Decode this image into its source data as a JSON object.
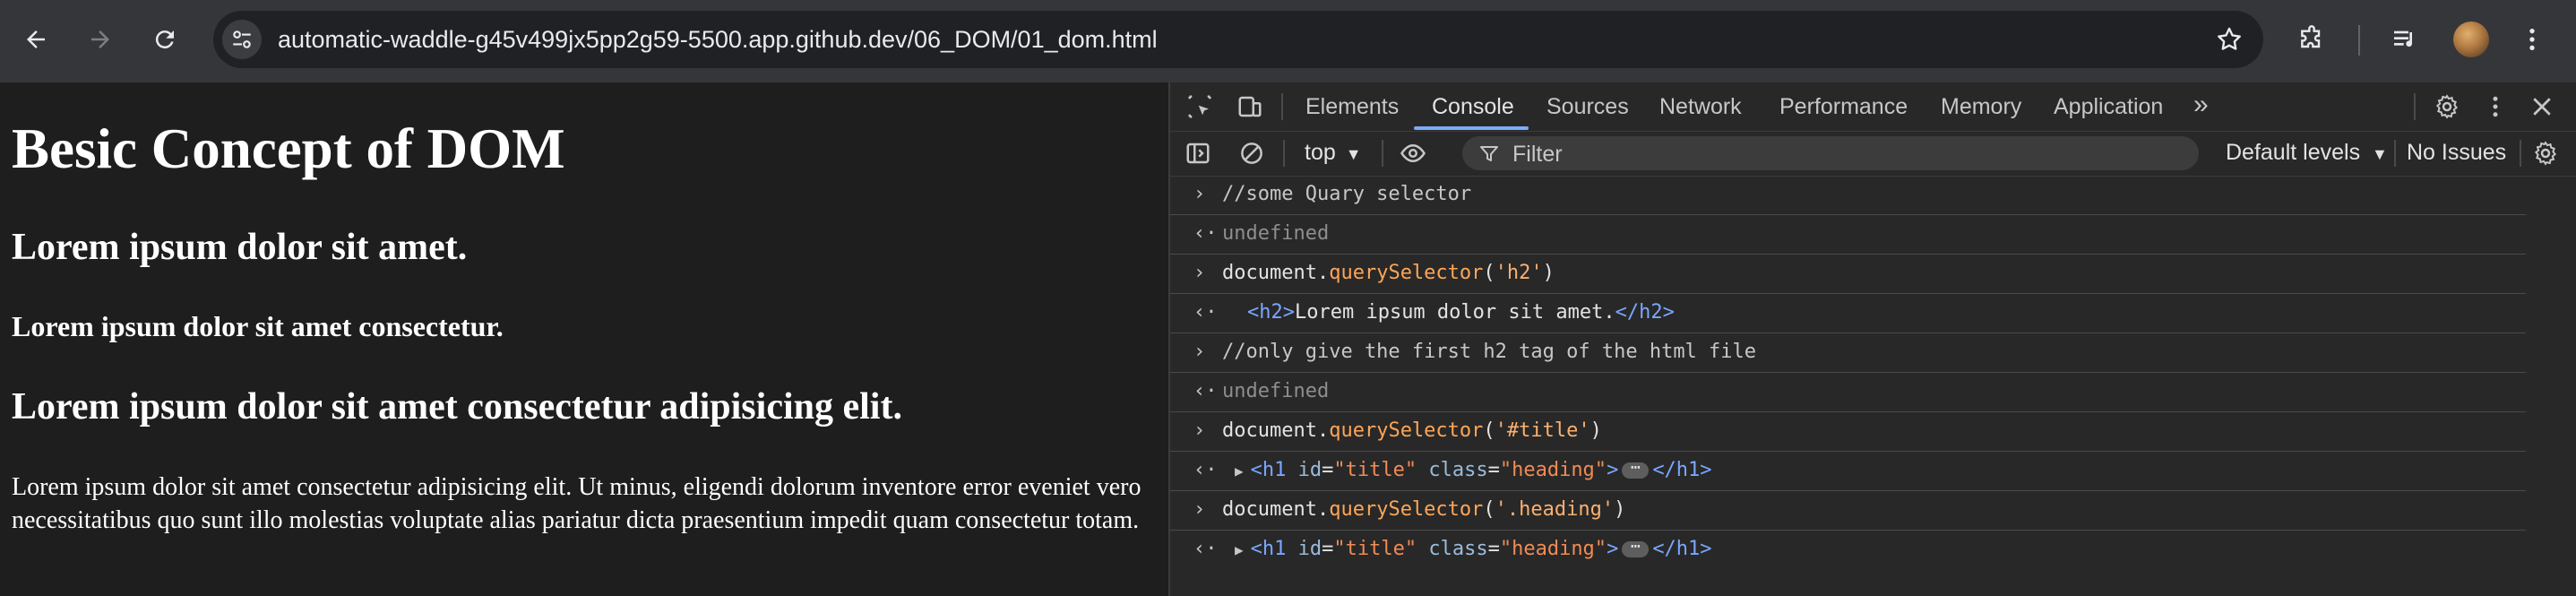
{
  "browser": {
    "url": "automatic-waddle-g45v499jx5pp2g59-5500.app.github.dev/06_DOM/01_dom.html",
    "icons": [
      "back-icon",
      "forward-icon",
      "reload-icon",
      "site-info-icon",
      "star-icon",
      "extensions-icon",
      "media-control-icon",
      "profile-avatar"
    ]
  },
  "page": {
    "h1": "Besic Concept of DOM",
    "h2_a": "Lorem ipsum dolor sit amet.",
    "h3": "Lorem ipsum dolor sit amet consectetur.",
    "h2_b": "Lorem ipsum dolor sit amet consectetur adipisicing elit.",
    "paragraph": "Lorem ipsum dolor sit amet consectetur adipisicing elit. Ut minus, eligendi dolorum inventore error eveniet vero necessitatibus quo sunt illo molestias voluptate alias pariatur dicta praesentium impedit quam consectetur totam."
  },
  "devtools": {
    "tabs": [
      "Elements",
      "Console",
      "Sources",
      "Network",
      "Performance",
      "Memory",
      "Application"
    ],
    "active_tab": "Console",
    "more_tabs": "»",
    "context": "top",
    "filter_placeholder": "Filter",
    "levels": "Default levels",
    "issues": "No Issues",
    "accent_color": "#7cacf8"
  },
  "console": {
    "r1_text": "//some Quary selector",
    "r2_text": "undefined",
    "r3_obj": "document.",
    "r3_method": "querySelector",
    "r3_open": "(",
    "r3_arg": "'h2'",
    "r3_close": ")",
    "r4_open": "<h2>",
    "r4_text": "Lorem ipsum dolor sit amet.",
    "r4_close": "</h2>",
    "r5_text": "//only give the first h2 tag of the html file",
    "r6_text": "undefined",
    "r7_obj": "document.",
    "r7_method": "querySelector",
    "r7_open": "(",
    "r7_arg": "'#title'",
    "r7_close": ")",
    "r8_tag": "<h1",
    "r8_attr1": "id",
    "r8_val1": "\"title\"",
    "r8_attr2": "class",
    "r8_val2": "\"heading\"",
    "r8_gt": ">",
    "r8_ellipsis": "⋯",
    "r8_close": "</h1>",
    "r9_obj": "document.",
    "r9_method": "querySelector",
    "r9_open": "(",
    "r9_arg": "'.heading'",
    "r9_close": ")",
    "r10_tag": "<h1",
    "r10_attr1": "id",
    "r10_val1": "\"title\"",
    "r10_attr2": "class",
    "r10_val2": "\"heading\"",
    "r10_gt": ">",
    "r10_ellipsis": "⋯",
    "r10_close": "</h1>",
    "input_prompt": "›",
    "output_prompt": "‹·"
  }
}
